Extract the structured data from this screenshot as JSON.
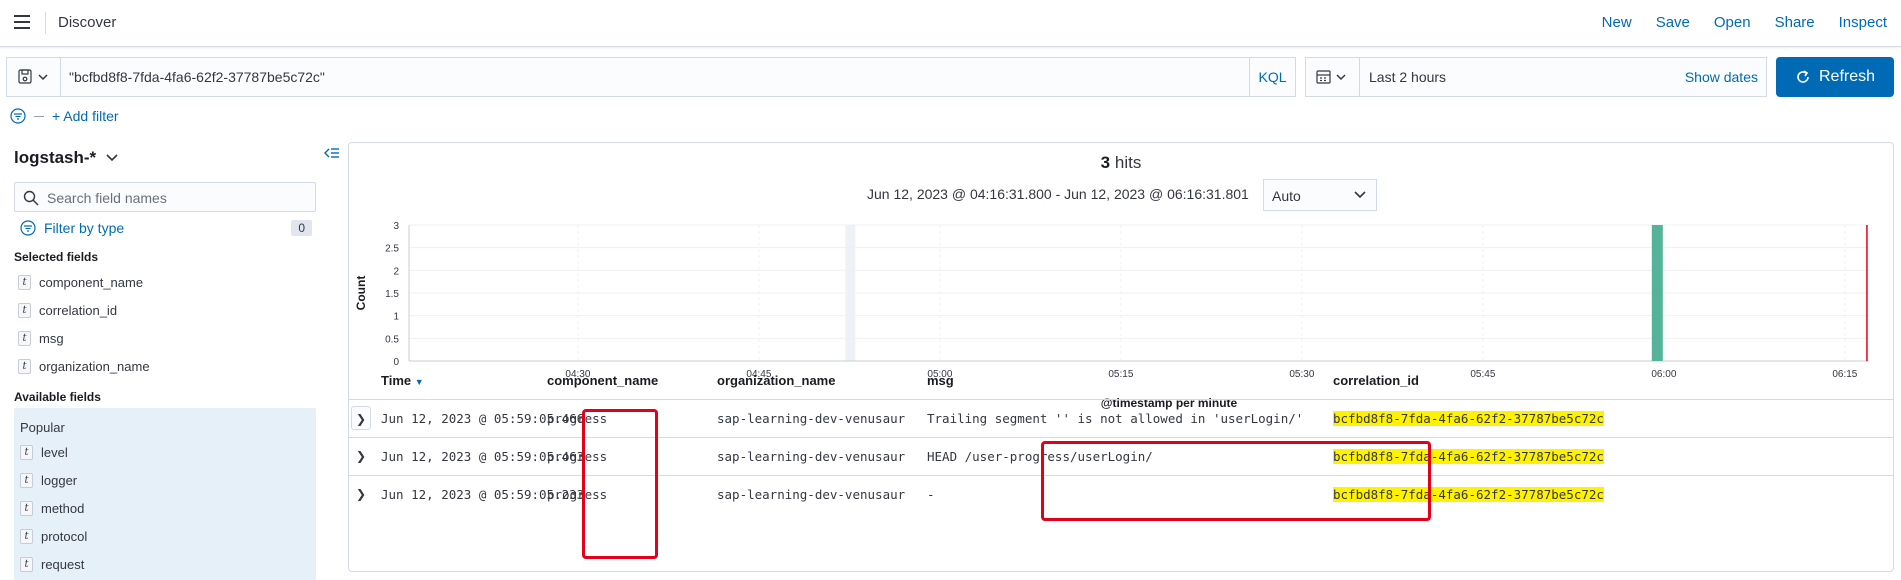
{
  "header": {
    "app_title": "Discover",
    "links": [
      "New",
      "Save",
      "Open",
      "Share",
      "Inspect"
    ]
  },
  "query": {
    "value": "\"bcfbd8f8-7fda-4fa6-62f2-37787be5c72c\"",
    "language": "KQL"
  },
  "datepicker": {
    "range": "Last 2 hours",
    "show_dates": "Show dates"
  },
  "refresh_label": "Refresh",
  "add_filter_label": "+ Add filter",
  "sidebar": {
    "index_pattern": "logstash-*",
    "search_placeholder": "Search field names",
    "filter_by_type": "Filter by type",
    "filter_count": "0",
    "selected_heading": "Selected fields",
    "selected_fields": [
      "component_name",
      "correlation_id",
      "msg",
      "organization_name"
    ],
    "available_heading": "Available fields",
    "popular_heading": "Popular",
    "popular_fields": [
      "level",
      "logger",
      "method",
      "protocol",
      "request"
    ],
    "field_type_glyph": "t"
  },
  "histogram": {
    "hits_count": "3",
    "hits_label": "hits",
    "time_range": "Jun 12, 2023 @ 04:16:31.800 - Jun 12, 2023 @ 06:16:31.801",
    "interval": "Auto",
    "xlabel": "@timestamp per minute"
  },
  "chart_data": {
    "type": "bar",
    "ylabel": "Count",
    "xlabel": "@timestamp per minute",
    "ylim": [
      0,
      3
    ],
    "y_ticks": [
      "0",
      "0.5",
      "1",
      "1.5",
      "2",
      "2.5",
      "3"
    ],
    "x_ticks": [
      "04:30",
      "04:45",
      "05:00",
      "05:15",
      "05:30",
      "05:45",
      "06:00",
      "06:15"
    ],
    "series": [
      {
        "x": [
          "05:59"
        ],
        "values": [
          3
        ]
      }
    ],
    "bar_color": "#54b399",
    "now_line_color": "#e3001b",
    "grid": true
  },
  "table": {
    "columns": [
      "Time",
      "component_name",
      "organization_name",
      "msg",
      "correlation_id"
    ],
    "rows": [
      {
        "time": "Jun 12, 2023 @ 05:59:05.466",
        "component_name": "progress",
        "organization_name": "sap-learning-dev-venusaur",
        "msg": "Trailing segment '' is not allowed in 'userLogin/'",
        "correlation_id": "bcfbd8f8-7fda-4fa6-62f2-37787be5c72c"
      },
      {
        "time": "Jun 12, 2023 @ 05:59:05.463",
        "component_name": "progress",
        "organization_name": "sap-learning-dev-venusaur",
        "msg": "HEAD /user-progress/userLogin/",
        "correlation_id": "bcfbd8f8-7fda-4fa6-62f2-37787be5c72c"
      },
      {
        "time": "Jun 12, 2023 @ 05:59:05.233",
        "component_name": "progress",
        "organization_name": "sap-learning-dev-venusaur",
        "msg": "-",
        "correlation_id": "bcfbd8f8-7fda-4fa6-62f2-37787be5c72c"
      }
    ]
  }
}
